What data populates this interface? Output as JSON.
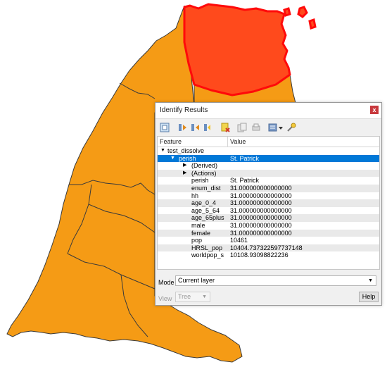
{
  "colors": {
    "parish_fill": "#f59b15",
    "highlight_fill": "#ff4a1c",
    "highlight_outline": "#ff0a0a",
    "boundary": "#3a3a3a",
    "selection": "#0078d7"
  },
  "dialog": {
    "title": "Identify Results",
    "close_label": "x",
    "toolbar_icons": [
      "expand-tree-icon",
      "expand-all-icon",
      "collapse-all-icon",
      "expand-new-icon",
      "clear-results-icon",
      "copy-feature-icon",
      "print-icon",
      "settings-dropdown-icon",
      "identify-tool-icon"
    ],
    "columns": {
      "feature": "Feature",
      "value": "Value"
    },
    "tree": {
      "layer": "test_dissolve",
      "feature_field": "perish",
      "feature_value": "St. Patrick",
      "derived_label": "(Derived)",
      "actions_label": "(Actions)",
      "attributes": [
        {
          "name": "perish",
          "value": "St. Patrick"
        },
        {
          "name": "enum_dist",
          "value": "31.000000000000000"
        },
        {
          "name": "hh",
          "value": "31.000000000000000"
        },
        {
          "name": "age_0_4",
          "value": "31.000000000000000"
        },
        {
          "name": "age_5_64",
          "value": "31.000000000000000"
        },
        {
          "name": "age_65plus",
          "value": "31.000000000000000"
        },
        {
          "name": "male",
          "value": "31.000000000000000"
        },
        {
          "name": "female",
          "value": "31.000000000000000"
        },
        {
          "name": "pop",
          "value": "10461"
        },
        {
          "name": "HRSL_pop",
          "value": "10404.737322597737148"
        },
        {
          "name": "worldpop_s",
          "value": "10108.93098822236"
        }
      ]
    },
    "mode": {
      "label": "Mode",
      "value": "Current layer"
    },
    "view": {
      "label": "View",
      "value": "Tree"
    },
    "help_label": "Help"
  }
}
